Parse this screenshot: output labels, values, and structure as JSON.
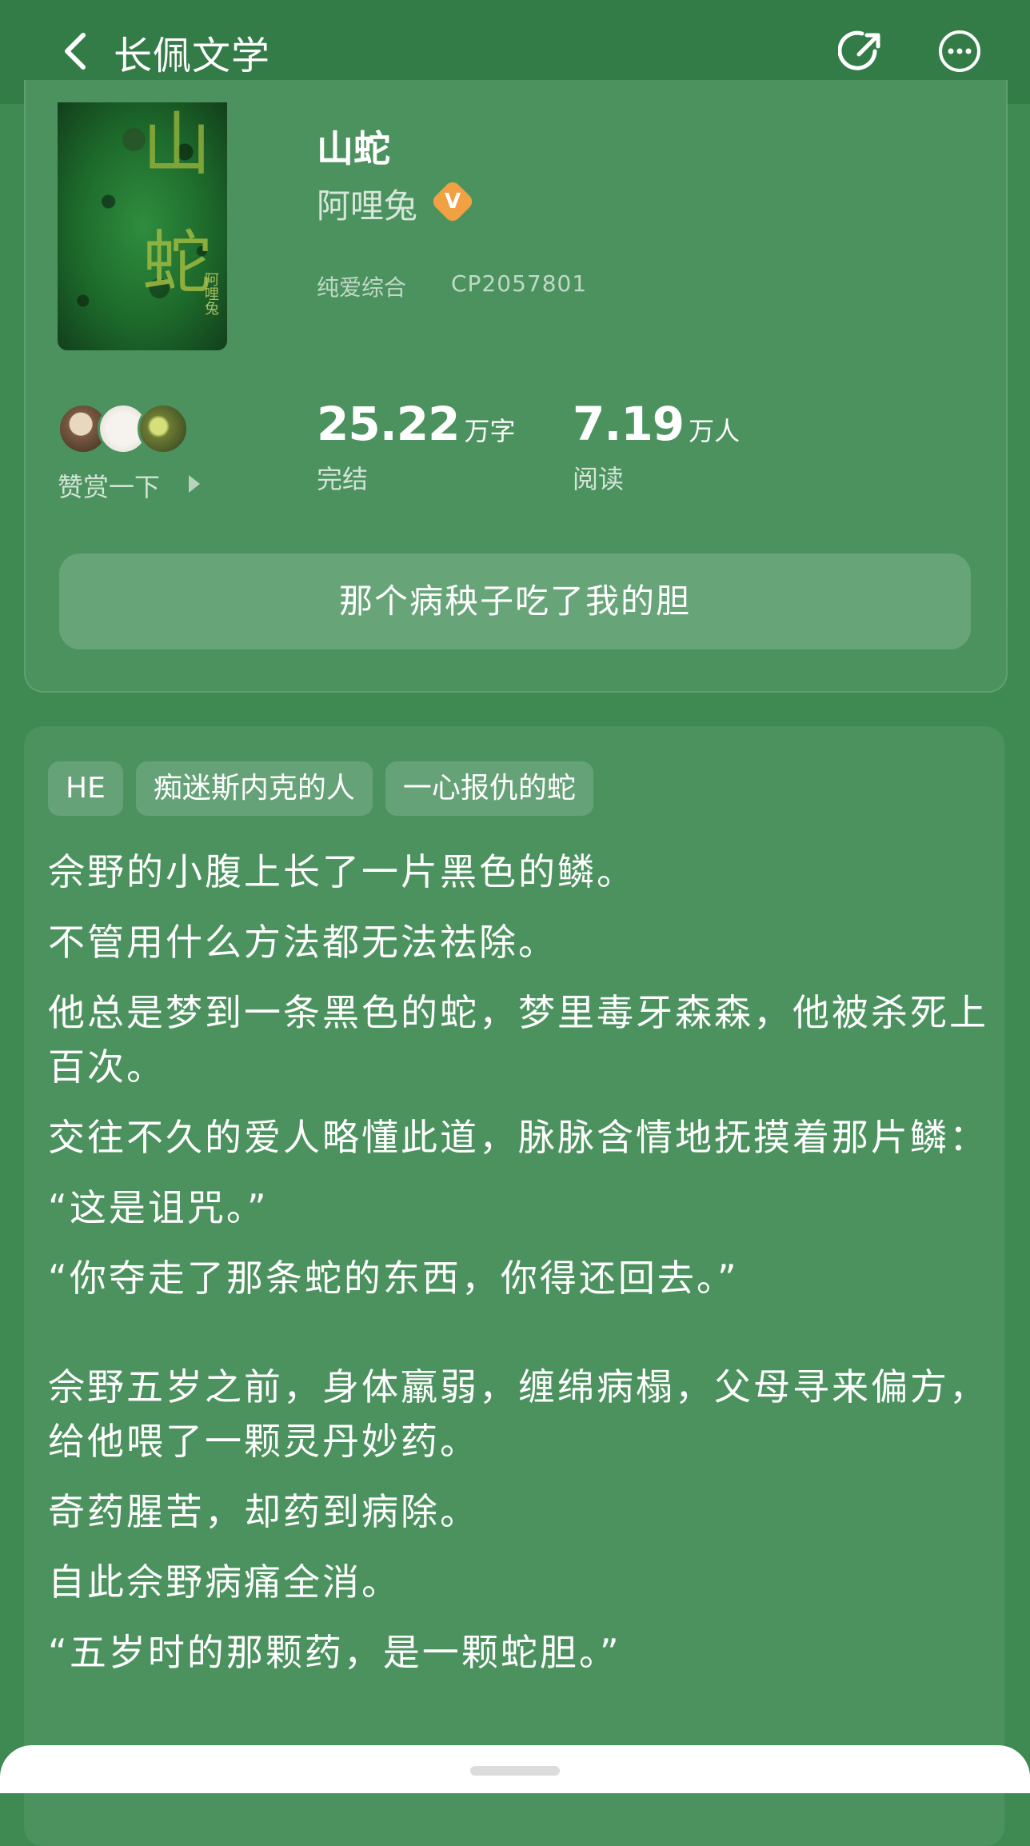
{
  "header": {
    "title": "长佩文学"
  },
  "book": {
    "title": "山蛇",
    "author": "阿哩兔",
    "verified_badge": "V",
    "genre": "纯爱综合",
    "id": "CP2057801",
    "cover": {
      "char1": "山",
      "char2": "蛇",
      "author": "阿哩兔"
    },
    "tip_label": "赞赏一下",
    "stats": [
      {
        "value": "25.22",
        "unit": "万字",
        "label": "完结"
      },
      {
        "value": "7.19",
        "unit": "万人",
        "label": "阅读"
      }
    ],
    "subtitle": "那个病秧子吃了我的胆"
  },
  "intro": {
    "tags": [
      "HE",
      "痴迷斯内克的人",
      "一心报仇的蛇"
    ],
    "paragraphs": [
      "佘野的小腹上长了一片黑色的鳞。",
      "不管用什么方法都无法祛除。",
      "他总是梦到一条黑色的蛇，梦里毒牙森森，他被杀死上百次。",
      "交往不久的爱人略懂此道，脉脉含情地抚摸着那片鳞：",
      "“这是诅咒。”",
      "“你夺走了那条蛇的东西，你得还回去。”",
      "",
      "佘野五岁之前，身体羸弱，缠绵病榻，父母寻来偏方，给他喂了一颗灵丹妙药。",
      "奇药腥苦，却药到病除。",
      "自此佘野病痛全消。",
      "“五岁时的那颗药，是一颗蛇胆。”"
    ]
  },
  "colors": {
    "background": "#3f8a52",
    "card": "#4b925e",
    "badge": "#f1a043"
  }
}
